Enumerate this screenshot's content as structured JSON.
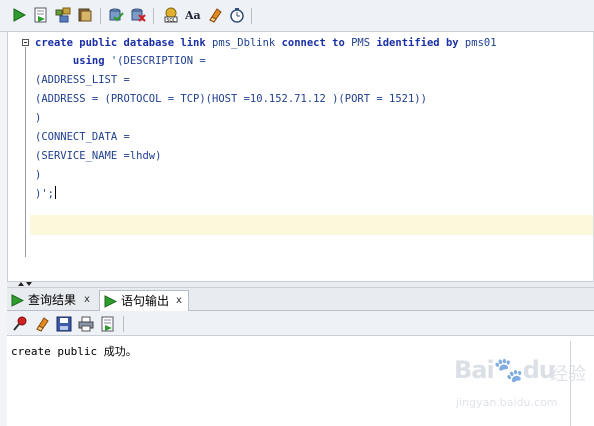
{
  "toolbar": {
    "icons": [
      "run-icon",
      "run-script-icon",
      "explain-plan-icon",
      "autotrace-icon",
      "commit-icon",
      "rollback-icon",
      "sql-tuning-icon",
      "format-case-icon",
      "clear-icon",
      "history-icon"
    ]
  },
  "editor": {
    "lines": [
      {
        "parts": [
          {
            "t": "create public database link ",
            "kw": true
          },
          {
            "t": "pms_Dblink ",
            "kw": false
          },
          {
            "t": "connect to ",
            "kw": true
          },
          {
            "t": "PMS ",
            "kw": false
          },
          {
            "t": "identified by ",
            "kw": true
          },
          {
            "t": "pms01",
            "kw": false
          }
        ]
      },
      {
        "parts": [
          {
            "t": "      using ",
            "kw": true
          },
          {
            "t": "'(DESCRIPTION =",
            "kw": false
          }
        ]
      },
      {
        "parts": [
          {
            "t": "(ADDRESS_LIST =",
            "kw": false
          }
        ]
      },
      {
        "parts": [
          {
            "t": "(ADDRESS = (PROTOCOL = TCP)(HOST =10.152.71.12 )(PORT = 1521))",
            "kw": false
          }
        ]
      },
      {
        "parts": [
          {
            "t": ")",
            "kw": false
          }
        ]
      },
      {
        "parts": [
          {
            "t": "(CONNECT_DATA =",
            "kw": false
          }
        ]
      },
      {
        "parts": [
          {
            "t": "(SERVICE_NAME =lhdw)",
            "kw": false
          }
        ]
      },
      {
        "parts": [
          {
            "t": ")",
            "kw": false
          }
        ]
      },
      {
        "parts": [
          {
            "t": ")';",
            "kw": false
          }
        ]
      }
    ]
  },
  "tabs": [
    {
      "label": "查询结果",
      "close": "x",
      "active": false
    },
    {
      "label": "语句输出",
      "close": "x",
      "active": true
    }
  ],
  "output_toolbar": {
    "icons": [
      "pin-icon",
      "eraser-icon",
      "save-icon",
      "print-icon",
      "export-icon"
    ]
  },
  "output": {
    "text": "create public 成功。"
  },
  "watermark": {
    "brand": "Bai",
    "brand2": "du",
    "cn": "经验",
    "url": "jingyan.baidu.com"
  }
}
